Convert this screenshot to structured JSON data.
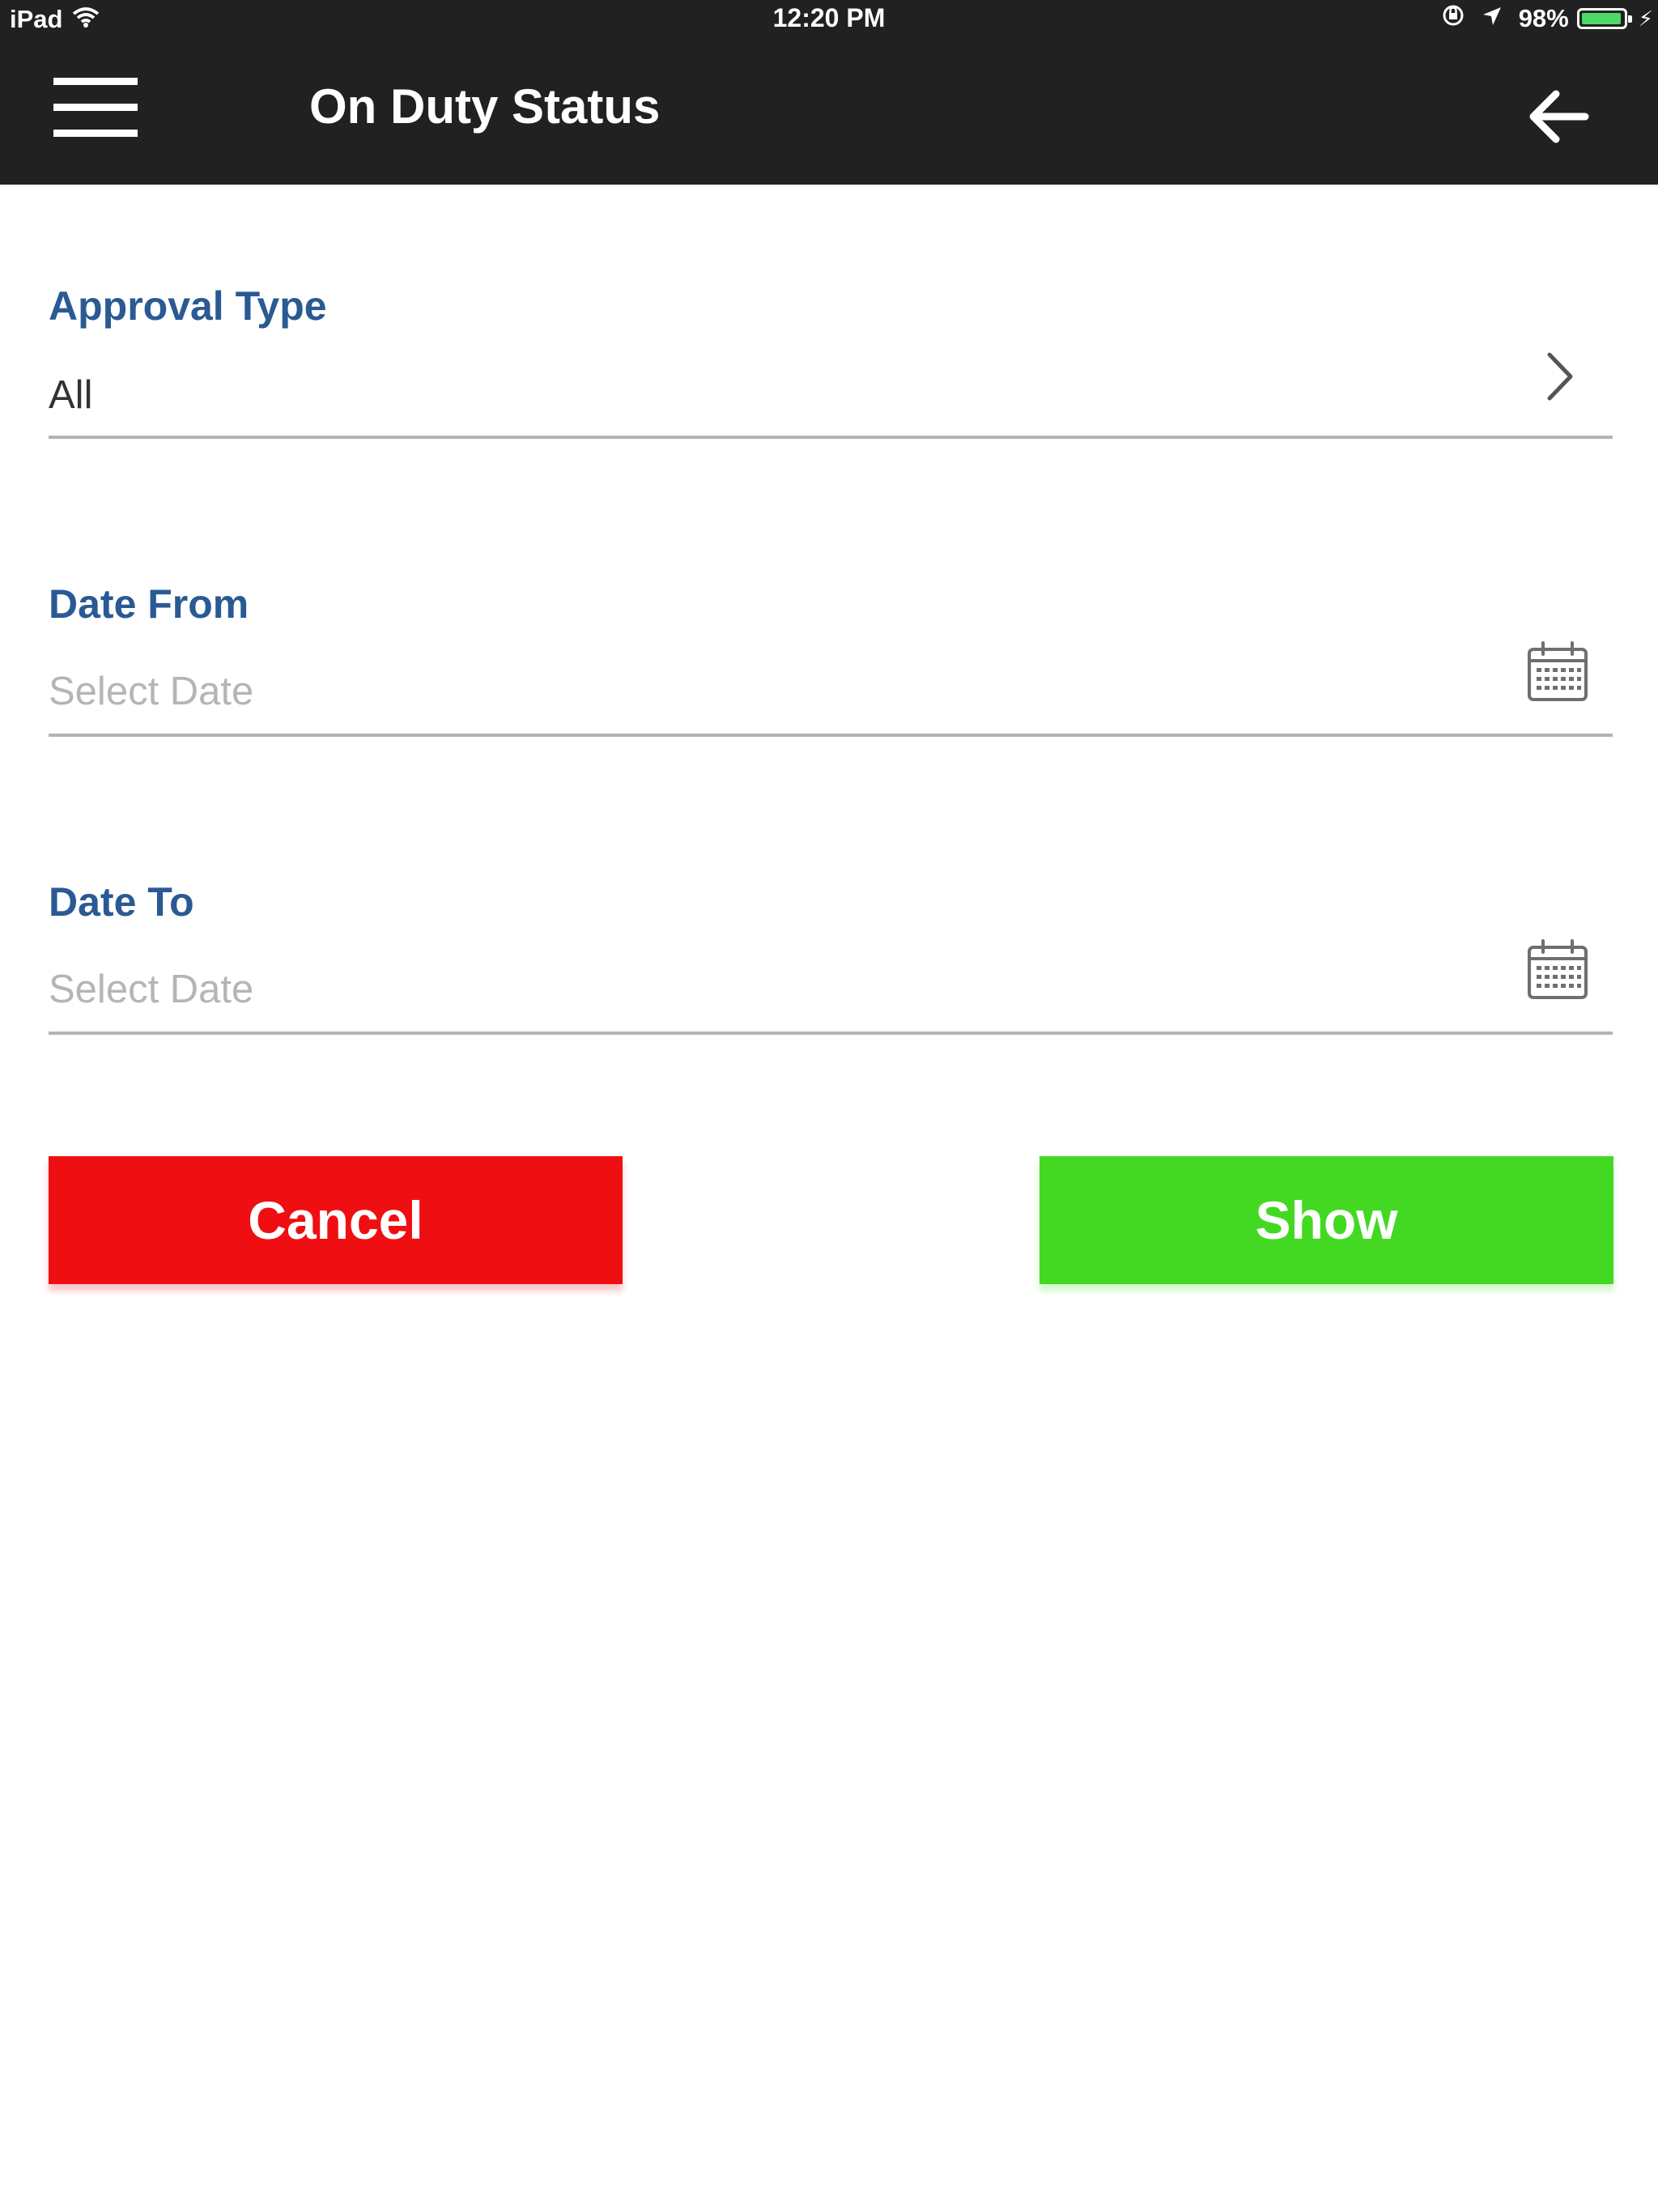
{
  "status_bar": {
    "device": "iPad",
    "time": "12:20 PM",
    "battery": "98%",
    "battery_level": 0.98
  },
  "header": {
    "title": "On Duty Status",
    "menu_icon": "hamburger-menu-icon",
    "back_icon": "back-arrow-icon"
  },
  "form": {
    "approval_type": {
      "label": "Approval Type",
      "value": "All",
      "icon": "chevron-right-icon"
    },
    "date_from": {
      "label": "Date From",
      "placeholder": "Select Date",
      "icon": "calendar-icon"
    },
    "date_to": {
      "label": "Date To",
      "placeholder": "Select Date",
      "icon": "calendar-icon"
    }
  },
  "actions": {
    "cancel_label": "Cancel",
    "show_label": "Show",
    "cancel_color": "#ef0f12",
    "show_color": "#43d922"
  },
  "colors": {
    "header_bg": "#212121",
    "label": "#2a5a93",
    "divider": "#b4b4b4"
  }
}
